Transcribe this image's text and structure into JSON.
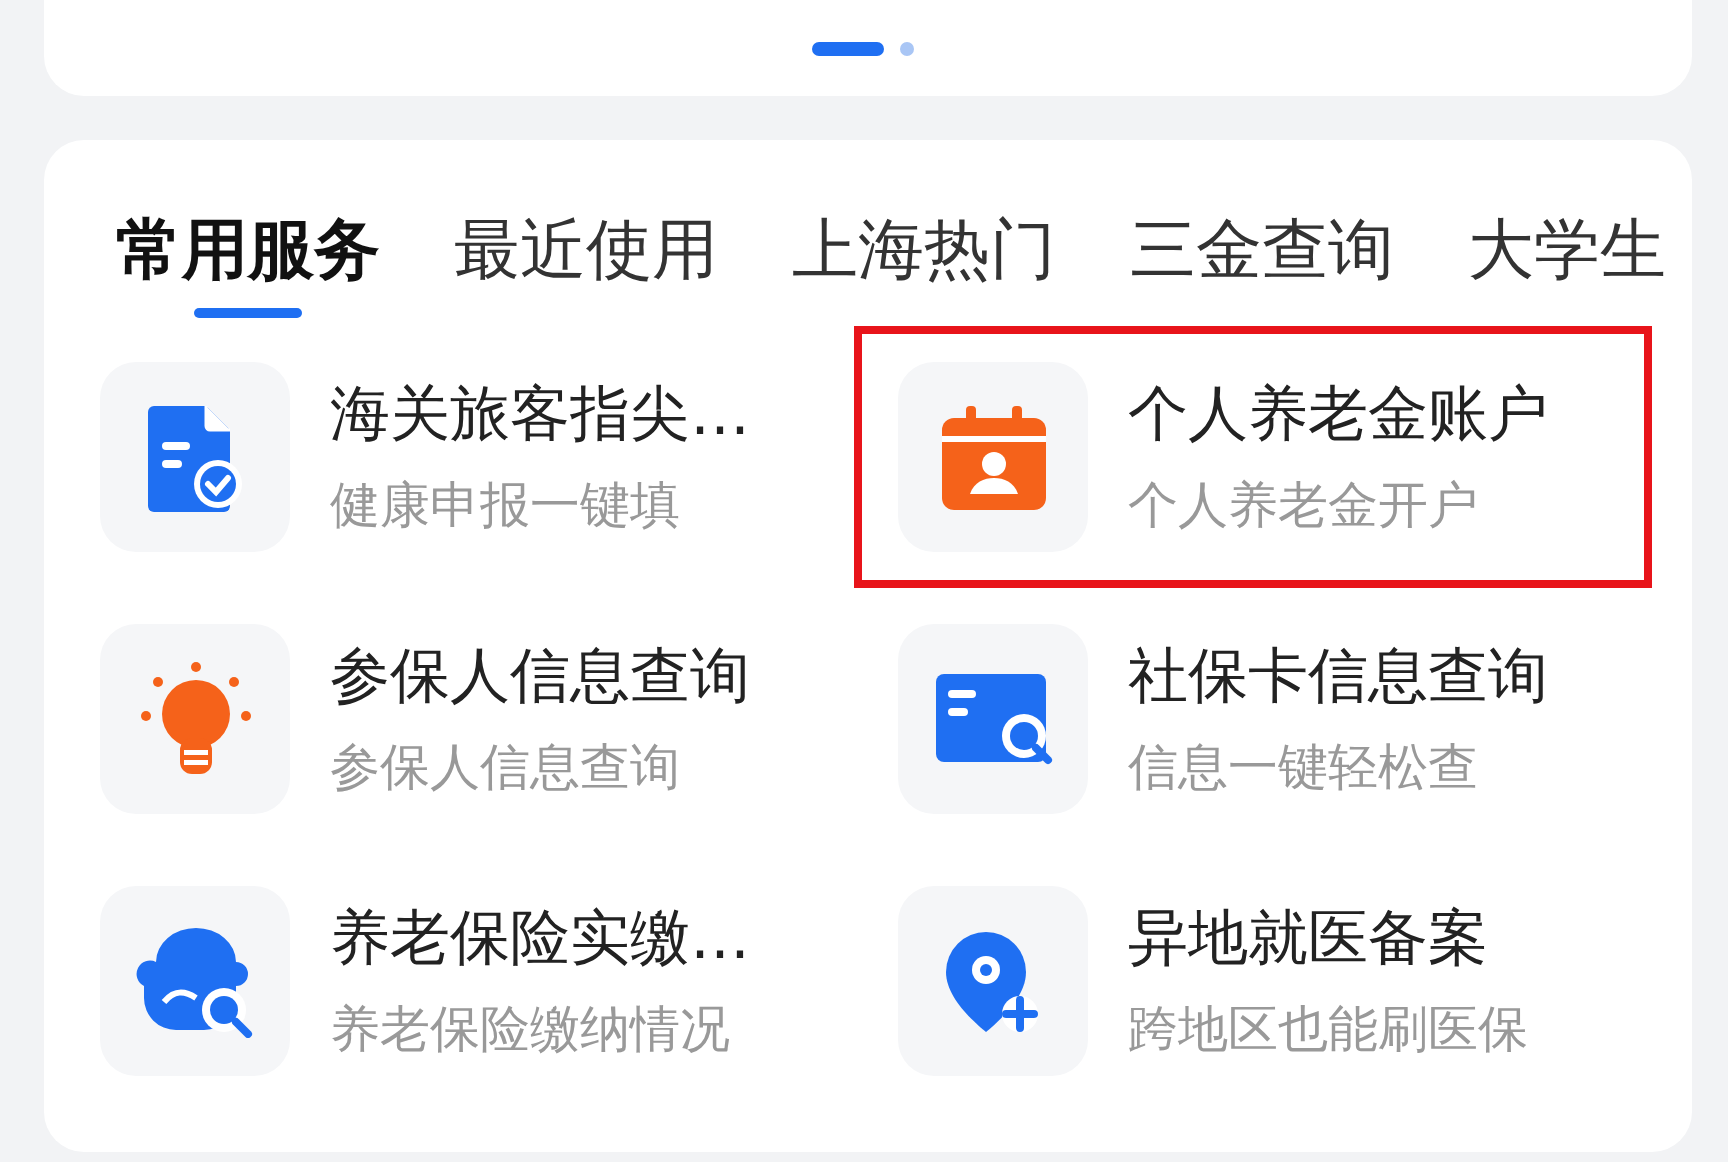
{
  "pager": {
    "dots": [
      {
        "selected": true
      },
      {
        "selected": false
      }
    ]
  },
  "tabs": [
    {
      "label": "常用服务",
      "selected": true
    },
    {
      "label": "最近使用",
      "selected": false
    },
    {
      "label": "上海热门",
      "selected": false
    },
    {
      "label": "三金查询",
      "selected": false
    },
    {
      "label": "大学生",
      "selected": false
    }
  ],
  "services": [
    {
      "title": "海关旅客指尖…",
      "subtitle": "健康申报一键填",
      "highlighted": false
    },
    {
      "title": "个人养老金账户",
      "subtitle": "个人养老金开户",
      "highlighted": true
    },
    {
      "title": "参保人信息查询",
      "subtitle": "参保人信息查询",
      "highlighted": false
    },
    {
      "title": "社保卡信息查询",
      "subtitle": "信息一键轻松查",
      "highlighted": false
    },
    {
      "title": "养老保险实缴…",
      "subtitle": "养老保险缴纳情况",
      "highlighted": false
    },
    {
      "title": "异地就医备案",
      "subtitle": "跨地区也能刷医保",
      "highlighted": false
    }
  ]
}
